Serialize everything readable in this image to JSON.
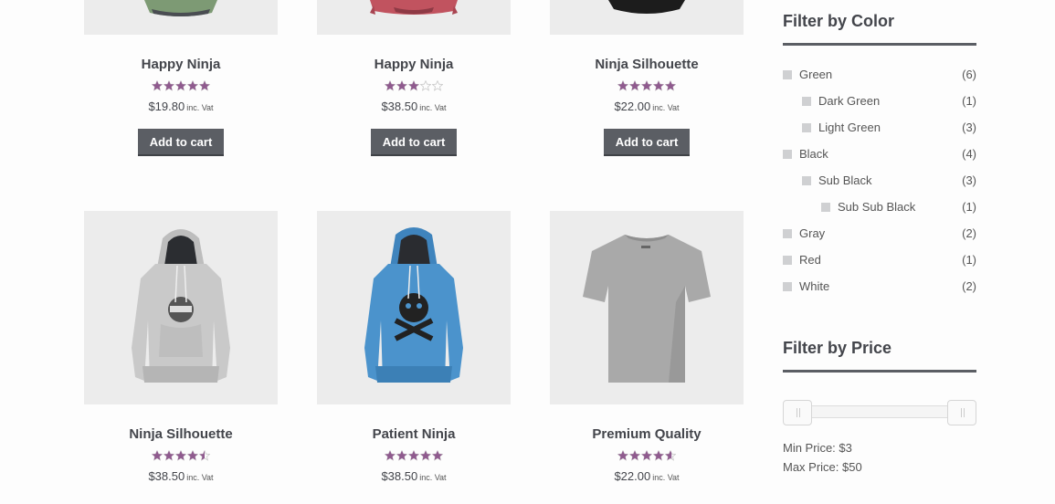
{
  "products": [
    {
      "title": "Happy Ninja",
      "rating": 5,
      "price": "$19.80",
      "suffix": "inc. Vat",
      "button": "Add to cart",
      "thumb": "hoodie-green"
    },
    {
      "title": "Happy Ninja",
      "rating": 3,
      "price": "$38.50",
      "suffix": "inc. Vat",
      "button": "Add to cart",
      "thumb": "hoodie-red"
    },
    {
      "title": "Ninja Silhouette",
      "rating": 5,
      "price": "$22.00",
      "suffix": "inc. Vat",
      "button": "Add to cart",
      "thumb": "tshirt-black"
    },
    {
      "title": "Ninja Silhouette",
      "rating": 4.5,
      "price": "$38.50",
      "suffix": "inc. Vat",
      "thumb": "hoodie-gray"
    },
    {
      "title": "Patient Ninja",
      "rating": 5,
      "price": "$38.50",
      "suffix": "inc. Vat",
      "thumb": "hoodie-blue"
    },
    {
      "title": "Premium Quality",
      "rating": 4.6,
      "price": "$22.00",
      "suffix": "inc. Vat",
      "thumb": "tshirt-gray"
    }
  ],
  "filter_color": {
    "title": "Filter by Color",
    "items": [
      {
        "name": "Green",
        "count": "(6)",
        "level": 0
      },
      {
        "name": "Dark Green",
        "count": "(1)",
        "level": 1
      },
      {
        "name": "Light Green",
        "count": "(3)",
        "level": 1
      },
      {
        "name": "Black",
        "count": "(4)",
        "level": 0
      },
      {
        "name": "Sub Black",
        "count": "(3)",
        "level": 1
      },
      {
        "name": "Sub Sub Black",
        "count": "(1)",
        "level": 2
      },
      {
        "name": "Gray",
        "count": "(2)",
        "level": 0
      },
      {
        "name": "Red",
        "count": "(1)",
        "level": 0
      },
      {
        "name": "White",
        "count": "(2)",
        "level": 0
      }
    ]
  },
  "filter_price": {
    "title": "Filter by Price",
    "min_label": "Min Price: $3",
    "max_label": "Max Price: $50"
  },
  "colors": {
    "star": "#8f5a8e",
    "star_empty": "#c8c8c8",
    "button_bg": "#5b5e64"
  }
}
